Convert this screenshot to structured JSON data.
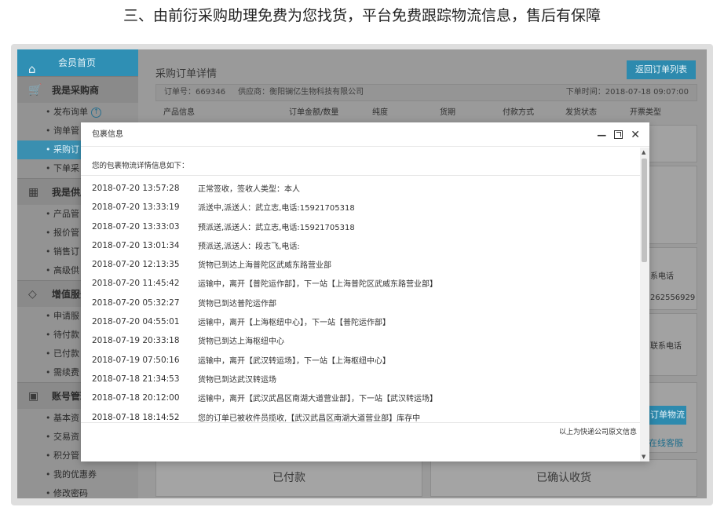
{
  "headline": "三、由前衍采购助理免费为您找货，平台免费跟踪物流信息，售后有保障",
  "sidebar": {
    "home": "会员首页",
    "groups": [
      {
        "label": "我是采购商",
        "items": [
          "发布询单",
          "询单管",
          "采购订",
          "下单采"
        ]
      },
      {
        "label": "我是供应",
        "items": [
          "产品管",
          "报价管",
          "销售订",
          "高级供"
        ]
      },
      {
        "label": "增值服务",
        "items": [
          "申请服",
          "待付款",
          "已付款",
          "需续费"
        ]
      },
      {
        "label": "账号管理",
        "items": [
          "基本资",
          "交易资",
          "积分管",
          "我的优惠券",
          "修改密码"
        ]
      }
    ]
  },
  "main": {
    "page_title": "采购订单详情",
    "back_button": "返回订单列表",
    "order_no": "订单号：669346",
    "supplier": "供应商：衡阳镧亿生物科技有限公司",
    "order_time": "下单时间：2018-07-18 09:07:00",
    "columns": [
      "产品信息",
      "订单金额/数量",
      "纯度",
      "货期",
      "付款方式",
      "发货状态",
      "开票类型"
    ],
    "ghost_price": "报价",
    "ghost_phone_label": "系电话",
    "ghost_phone": "262556929",
    "ghost_contact": "联系电话",
    "ghost_track_btn": "订单物流",
    "ghost_service": "在线客服",
    "status_paid": "已付款",
    "status_received": "已确认收货"
  },
  "modal": {
    "title": "包裹信息",
    "intro": "您的包裹物流详情信息如下：",
    "footer": "以上为快递公司原文信息",
    "tracks": [
      {
        "time": "2018-07-20 13:57:28",
        "msg": "正常签收，签收人类型：本人"
      },
      {
        "time": "2018-07-20 13:33:19",
        "msg": "派送中,派送人：武立志,电话:15921705318"
      },
      {
        "time": "2018-07-20 13:33:03",
        "msg": "预派送,派送人：武立志,电话:15921705318"
      },
      {
        "time": "2018-07-20 13:01:34",
        "msg": "预派送,派送人：段志飞,电话:"
      },
      {
        "time": "2018-07-20 12:13:35",
        "msg": "货物已到达上海普陀区武威东路营业部"
      },
      {
        "time": "2018-07-20 11:45:42",
        "msg": "运输中，离开【普陀运作部】，下一站【上海普陀区武威东路营业部】"
      },
      {
        "time": "2018-07-20 05:32:27",
        "msg": "货物已到达普陀运作部"
      },
      {
        "time": "2018-07-20 04:55:01",
        "msg": "运输中，离开【上海枢纽中心】，下一站【普陀运作部】"
      },
      {
        "time": "2018-07-19 20:33:18",
        "msg": "货物已到达上海枢纽中心"
      },
      {
        "time": "2018-07-19 07:50:16",
        "msg": "运输中，离开【武汉转运场】，下一站【上海枢纽中心】"
      },
      {
        "time": "2018-07-18 21:34:53",
        "msg": "货物已到达武汉转运场"
      },
      {
        "time": "2018-07-18 20:12:00",
        "msg": "运输中，离开【武汉武昌区南湖大道营业部】，下一站【武汉转运场】"
      },
      {
        "time": "2018-07-18 18:14:52",
        "msg": "您的订单已被收件员揽收,【武汉武昌区南湖大道营业部】库存中"
      }
    ]
  }
}
